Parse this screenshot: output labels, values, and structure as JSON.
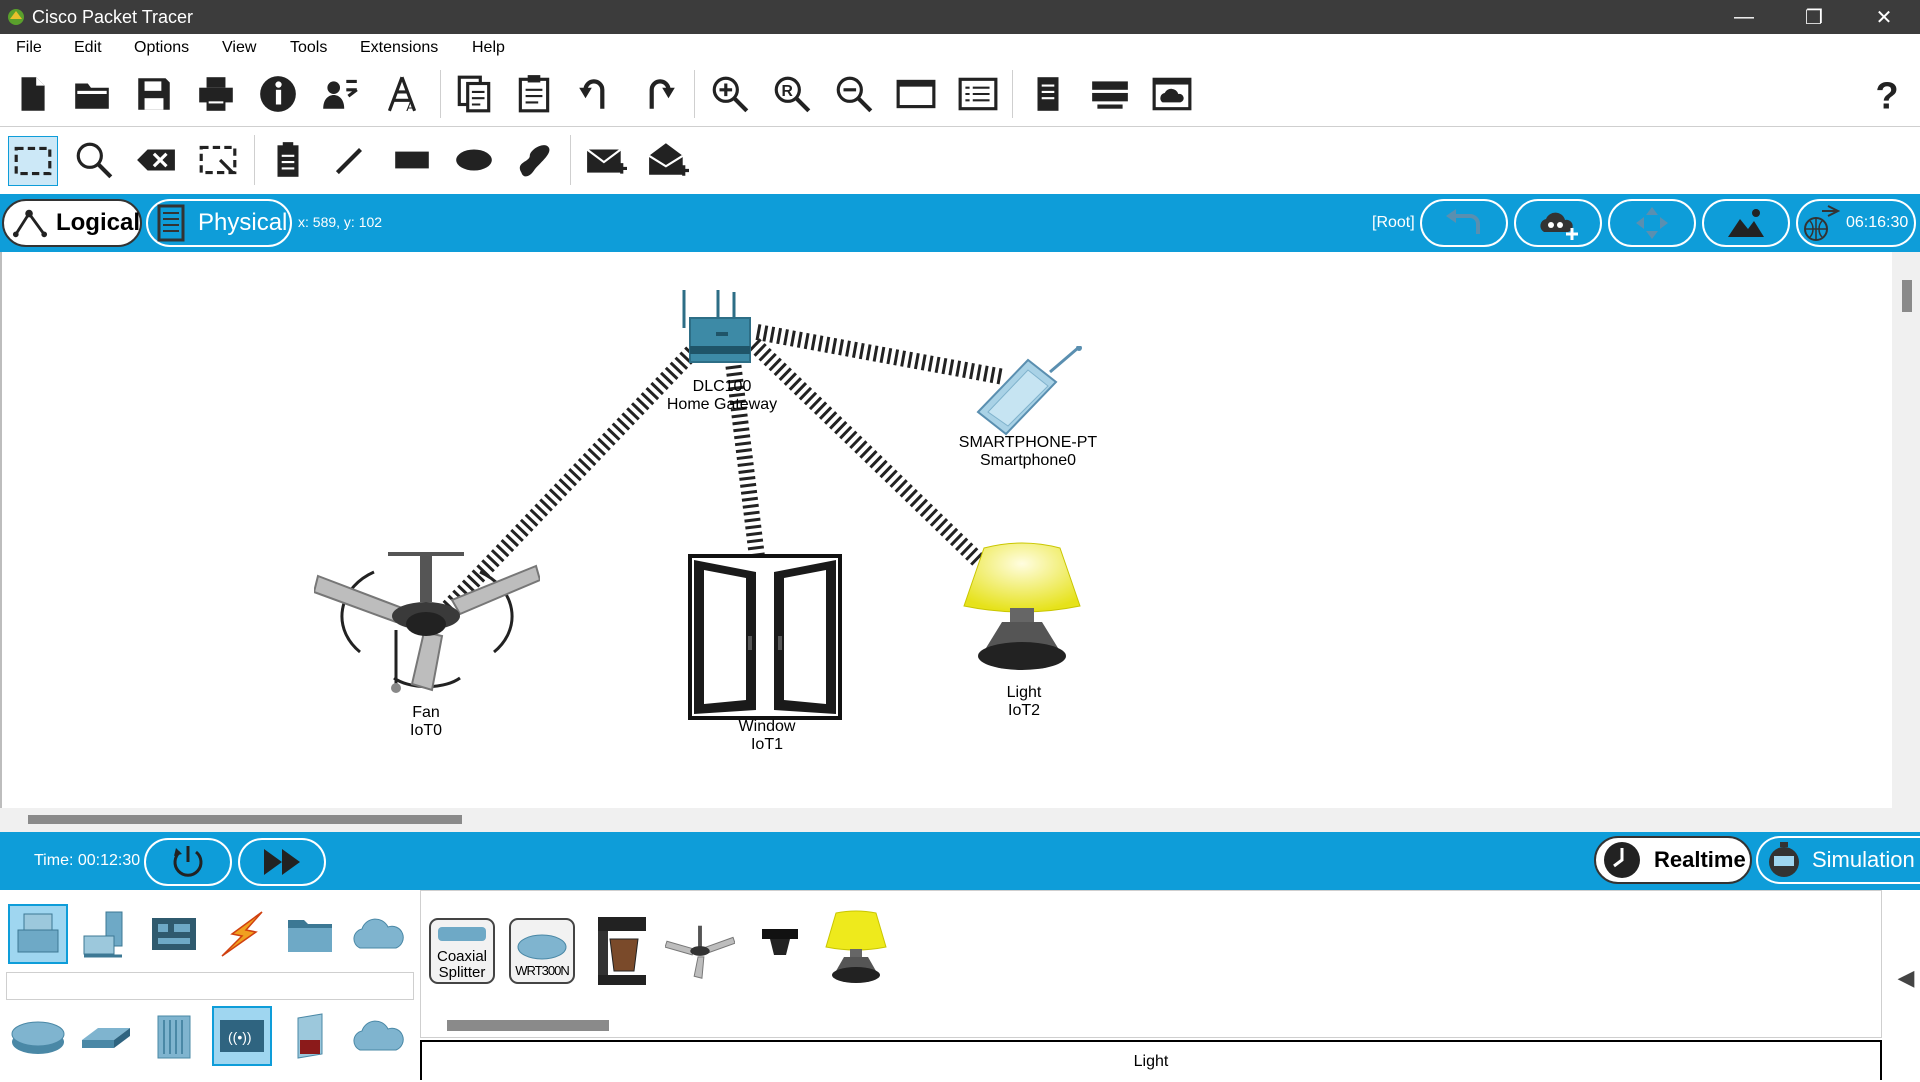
{
  "window": {
    "title": "Cisco Packet Tracer",
    "minimize": "—",
    "restore": "❐",
    "close": "✕"
  },
  "menu": [
    "File",
    "Edit",
    "Options",
    "View",
    "Tools",
    "Extensions",
    "Help"
  ],
  "workspace": {
    "logical_label": "Logical",
    "physical_label": "Physical",
    "coords": "x: 589, y: 102",
    "root": "[Root]",
    "clock": "06:16:30"
  },
  "devices": [
    {
      "name": "DLC100",
      "label": "Home Gateway"
    },
    {
      "name": "SMARTPHONE-PT",
      "label": "Smartphone0"
    },
    {
      "name": "Fan",
      "label": "IoT0"
    },
    {
      "name": "Window",
      "label": "IoT1"
    },
    {
      "name": "Light",
      "label": "IoT2"
    }
  ],
  "timebar": {
    "time": "Time: 00:12:30",
    "realtime": "Realtime",
    "simulation": "Simulation"
  },
  "device_list": [
    {
      "name": "Coaxial Splitter",
      "line1": "Coaxial",
      "line2": "Splitter"
    },
    {
      "name": "WRT300N",
      "line1": "WRT300N"
    },
    {
      "name": "coffee-maker"
    },
    {
      "name": "ceiling-fan"
    },
    {
      "name": "camera"
    },
    {
      "name": "lamp"
    }
  ],
  "selected_device": "Light",
  "colors": {
    "accent": "#0e9dd9",
    "titlebar": "#3c3c3c"
  }
}
